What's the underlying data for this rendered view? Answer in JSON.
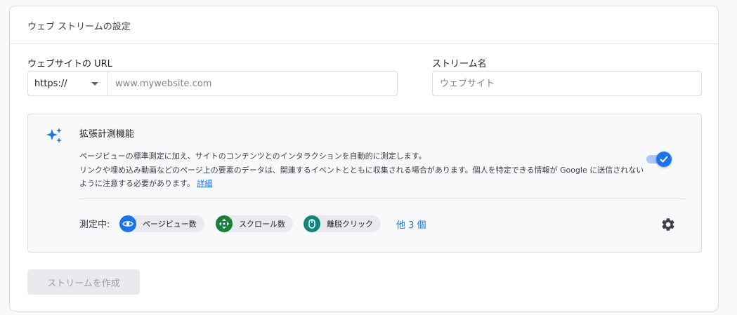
{
  "card": {
    "title": "ウェブ ストリームの設定"
  },
  "website_url": {
    "label": "ウェブサイトの URL",
    "protocol": "https://",
    "placeholder": "www.mywebsite.com",
    "value": ""
  },
  "stream_name": {
    "label": "ストリーム名",
    "placeholder": "ウェブサイト",
    "value": ""
  },
  "enhanced": {
    "title": "拡張計測機能",
    "desc_line1": "ページビューの標準測定に加え、サイトのコンテンツとのインタラクションを自動的に測定します。",
    "desc_line2": "リンクや埋め込み動画などのページ上の要素のデータは、関連するイベントとともに収集される場合があります。個人を特定できる情報が Google に送信されないように注意する必要があります。",
    "detail_link": "詳細",
    "toggle_on": true,
    "measuring_label": "測定中:",
    "chips": [
      {
        "label": "ページビュー数",
        "icon": "eye-icon",
        "color": "#1a73e8"
      },
      {
        "label": "スクロール数",
        "icon": "scroll-arrows-icon",
        "color": "#188038"
      },
      {
        "label": "離脱クリック",
        "icon": "mouse-icon",
        "color": "#12857a"
      }
    ],
    "more_link": "他 3 個",
    "settings_icon": "gear-icon"
  },
  "actions": {
    "create_label": "ストリームを作成"
  }
}
